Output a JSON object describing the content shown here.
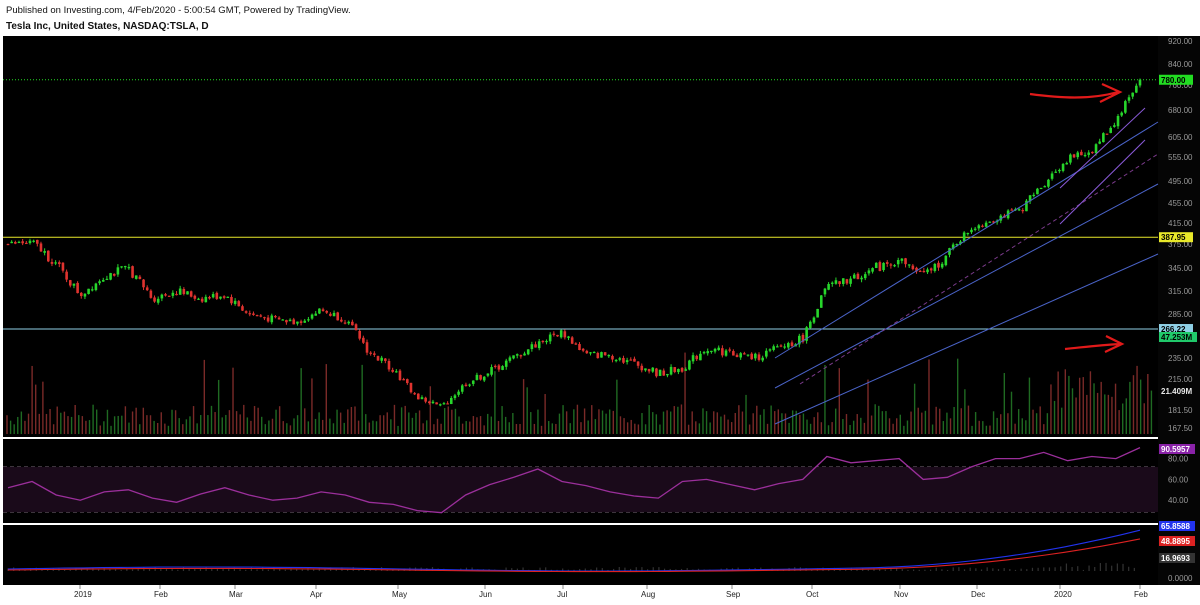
{
  "header": {
    "published": "Published on Investing.com, 4/Feb/2020 - 5:00:54 GMT, Powered by TradingView.",
    "instrument": "Tesla Inc, United States, NASDAQ:TSLA, D"
  },
  "colors": {
    "background": "#000000",
    "up": "#27d62b",
    "down": "#e0332f",
    "channel": "#4a63c8",
    "inner_channel": "#8a5ad8",
    "resistance_yellow": "#e8e82a",
    "support_blue": "#8fd0e6",
    "last_green": "#22dd22",
    "rsi": "#9b2f9b",
    "macd": "#2233ee",
    "signal": "#dd2222",
    "arrows": "#e11a1a"
  },
  "chart_data": [
    {
      "type": "candlestick",
      "name": "price",
      "x_axis": [
        "2019",
        "Feb",
        "Mar",
        "Apr",
        "May",
        "Jun",
        "Jul",
        "Aug",
        "Sep",
        "Oct",
        "Nov",
        "Dec",
        "2020",
        "Feb"
      ],
      "y_ticks": [
        920,
        840,
        760,
        680,
        605,
        555,
        495,
        455,
        415,
        375,
        345,
        315,
        285,
        255,
        235,
        215,
        181.5,
        167.5
      ],
      "ylim": [
        160,
        920
      ],
      "grid": false,
      "horizontal_levels": [
        {
          "value": 780.0,
          "label": "780.00",
          "color": "#22dd22"
        },
        {
          "value": 387.95,
          "label": "387.95",
          "color": "#e8e82a"
        },
        {
          "value": 266.22,
          "label": "266.22",
          "color": "#8fd0e6"
        }
      ],
      "close_points": [
        {
          "date": "Dec 2018",
          "close": 375
        },
        {
          "date": "Dec 2018",
          "close": 378
        },
        {
          "date": "2019",
          "close": 350
        },
        {
          "date": "Jan 2019",
          "close": 310
        },
        {
          "date": "Jan 2019",
          "close": 335
        },
        {
          "date": "Jan 2019",
          "close": 345
        },
        {
          "date": "Feb 2019",
          "close": 305
        },
        {
          "date": "Feb 2019",
          "close": 315
        },
        {
          "date": "Feb 2019",
          "close": 305
        },
        {
          "date": "Mar 2019",
          "close": 310
        },
        {
          "date": "Mar 2019",
          "close": 285
        },
        {
          "date": "Mar 2019",
          "close": 278
        },
        {
          "date": "Apr 2019",
          "close": 275
        },
        {
          "date": "Apr 2019",
          "close": 290
        },
        {
          "date": "Apr 2019",
          "close": 278
        },
        {
          "date": "May 2019",
          "close": 240
        },
        {
          "date": "May 2019",
          "close": 225
        },
        {
          "date": "May 2019",
          "close": 195
        },
        {
          "date": "Jun 2019",
          "close": 185
        },
        {
          "date": "Jun 2019",
          "close": 210
        },
        {
          "date": "Jun 2019",
          "close": 222
        },
        {
          "date": "Jul 2019",
          "close": 235
        },
        {
          "date": "Jul 2019",
          "close": 250
        },
        {
          "date": "Jul 2019",
          "close": 262
        },
        {
          "date": "Jul 2019",
          "close": 238
        },
        {
          "date": "Aug 2019",
          "close": 238
        },
        {
          "date": "Aug 2019",
          "close": 230
        },
        {
          "date": "Aug 2019",
          "close": 220
        },
        {
          "date": "Sep 2019",
          "close": 225
        },
        {
          "date": "Sep 2019",
          "close": 245
        },
        {
          "date": "Sep 2019",
          "close": 240
        },
        {
          "date": "Oct 2019",
          "close": 235
        },
        {
          "date": "Oct 2019",
          "close": 245
        },
        {
          "date": "Oct 2019",
          "close": 255
        },
        {
          "date": "Oct 2019",
          "close": 320
        },
        {
          "date": "Nov 2019",
          "close": 330
        },
        {
          "date": "Nov 2019",
          "close": 345
        },
        {
          "date": "Nov 2019",
          "close": 355
        },
        {
          "date": "Dec 2019",
          "close": 335
        },
        {
          "date": "Dec 2019",
          "close": 360
        },
        {
          "date": "Dec 2019",
          "close": 405
        },
        {
          "date": "Dec 2019",
          "close": 425
        },
        {
          "date": "2020",
          "close": 440
        },
        {
          "date": "Jan 2020",
          "close": 490
        },
        {
          "date": "Jan 2020",
          "close": 550
        },
        {
          "date": "Jan 2020",
          "close": 570
        },
        {
          "date": "Jan 2020",
          "close": 650
        },
        {
          "date": "Feb 2020",
          "close": 780
        }
      ]
    },
    {
      "type": "bar",
      "name": "volume",
      "labels": [
        "47.253M",
        "21.409M"
      ],
      "last_value": "47.253M",
      "reference_value": "21.409M"
    },
    {
      "type": "line",
      "name": "RSI",
      "y_ticks": [
        80,
        60,
        40
      ],
      "ylim": [
        20,
        95
      ],
      "last_value": "90.5957",
      "bands": [
        70,
        30
      ],
      "values": [
        52,
        58,
        45,
        40,
        48,
        50,
        42,
        38,
        46,
        52,
        45,
        40,
        42,
        48,
        45,
        38,
        36,
        30,
        28,
        45,
        55,
        62,
        70,
        58,
        54,
        48,
        44,
        42,
        58,
        60,
        55,
        50,
        56,
        60,
        82,
        76,
        78,
        80,
        60,
        62,
        72,
        80,
        80,
        86,
        78,
        82,
        80,
        90.6
      ]
    },
    {
      "type": "line",
      "name": "MACD",
      "last_values": [
        "65.8588",
        "48.8895",
        "16.9693"
      ],
      "y_ticks": [
        0
      ],
      "tick_labels": [
        "0.0000"
      ]
    }
  ],
  "annotations": {
    "arrow_top": "red arrow pointing right toward 780",
    "arrow_volume": "red arrow pointing right toward volume spike"
  }
}
